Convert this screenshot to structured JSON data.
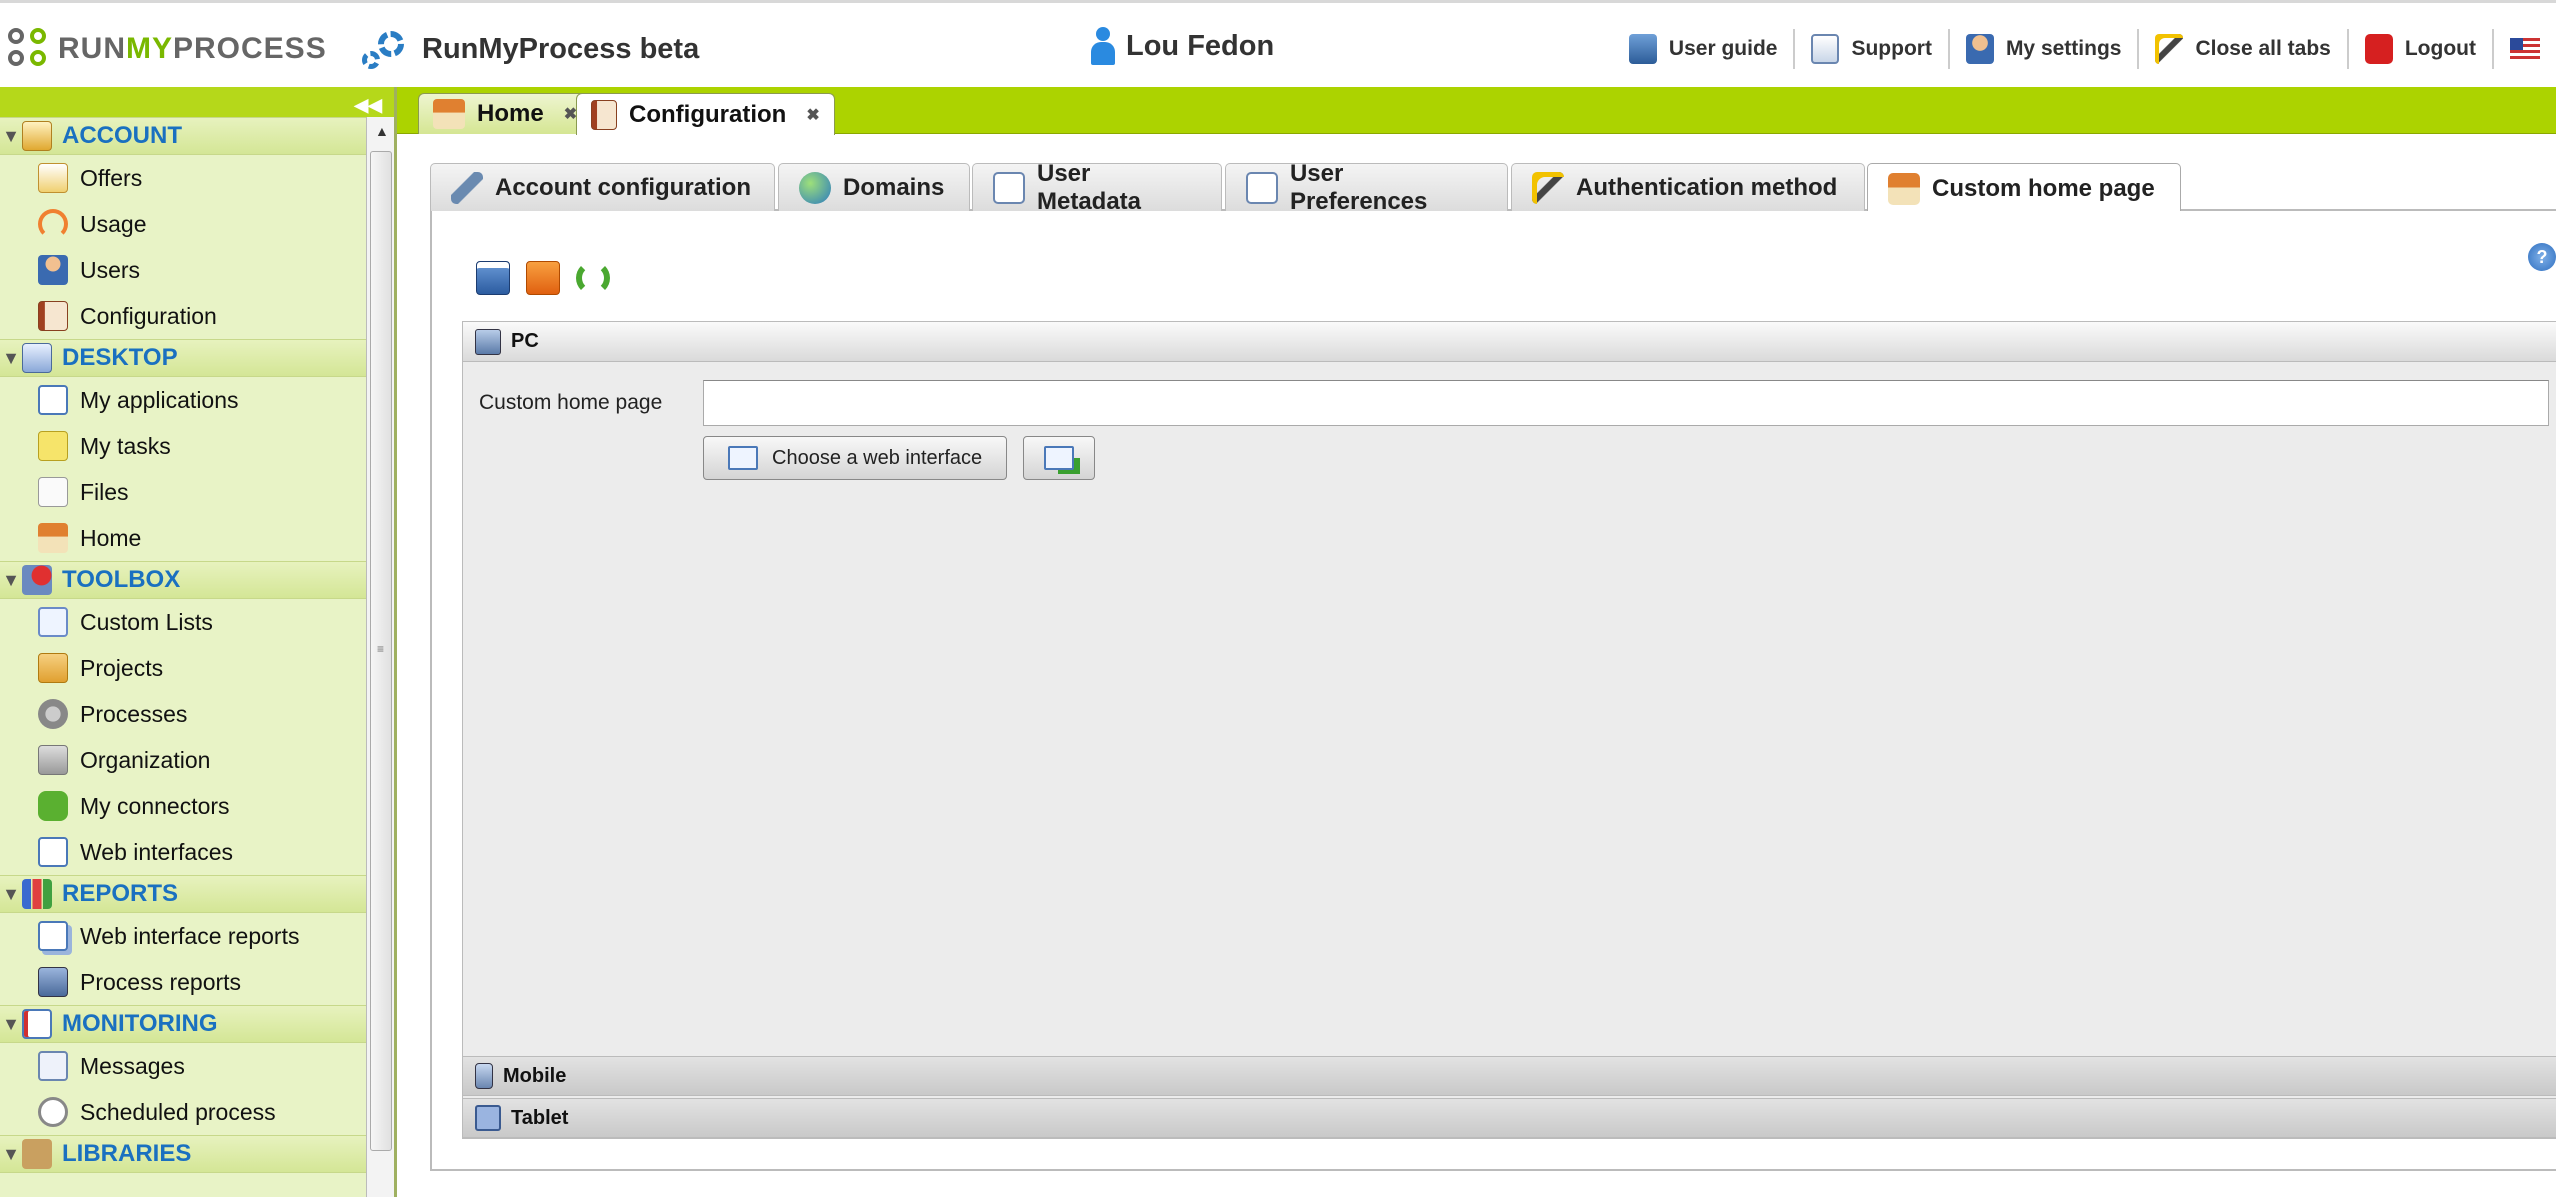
{
  "app": {
    "logo_run": "RUN",
    "logo_my": "MY",
    "logo_process": "PROCESS",
    "title": "RunMyProcess beta",
    "user": "Lou Fedon"
  },
  "toplinks": [
    {
      "label": "User guide",
      "icon": "book-icon"
    },
    {
      "label": "Support",
      "icon": "envelope-warning-icon"
    },
    {
      "label": "My settings",
      "icon": "user-settings-icon"
    },
    {
      "label": "Close all tabs",
      "icon": "magic-wand-icon"
    },
    {
      "label": "Logout",
      "icon": "power-icon"
    }
  ],
  "sidebar": {
    "sections": [
      {
        "label": "ACCOUNT",
        "items": [
          "Offers",
          "Usage",
          "Users",
          "Configuration"
        ]
      },
      {
        "label": "DESKTOP",
        "items": [
          "My applications",
          "My tasks",
          "Files",
          "Home"
        ]
      },
      {
        "label": "TOOLBOX",
        "items": [
          "Custom Lists",
          "Projects",
          "Processes",
          "Organization",
          "My connectors",
          "Web interfaces"
        ]
      },
      {
        "label": "REPORTS",
        "items": [
          "Web interface reports",
          "Process reports"
        ]
      },
      {
        "label": "MONITORING",
        "items": [
          "Messages",
          "Scheduled process"
        ]
      },
      {
        "label": "LIBRARIES",
        "items": []
      }
    ]
  },
  "main_tabs": [
    {
      "label": "Home",
      "close": "✖"
    },
    {
      "label": "Configuration",
      "close": "✖"
    }
  ],
  "sub_tabs": [
    "Account configuration",
    "Domains",
    "User Metadata",
    "User Preferences",
    "Authentication method",
    "Custom home page"
  ],
  "panel": {
    "help": "?",
    "sections": {
      "pc": "PC",
      "mobile": "Mobile",
      "tablet": "Tablet"
    },
    "custom_home_label": "Custom home page",
    "custom_home_value": "",
    "choose_button": "Choose a web interface"
  },
  "colors": {
    "accent_green": "#acd300",
    "link_blue": "#1a70c0",
    "sidebar_bg": "#e8f3c6"
  }
}
